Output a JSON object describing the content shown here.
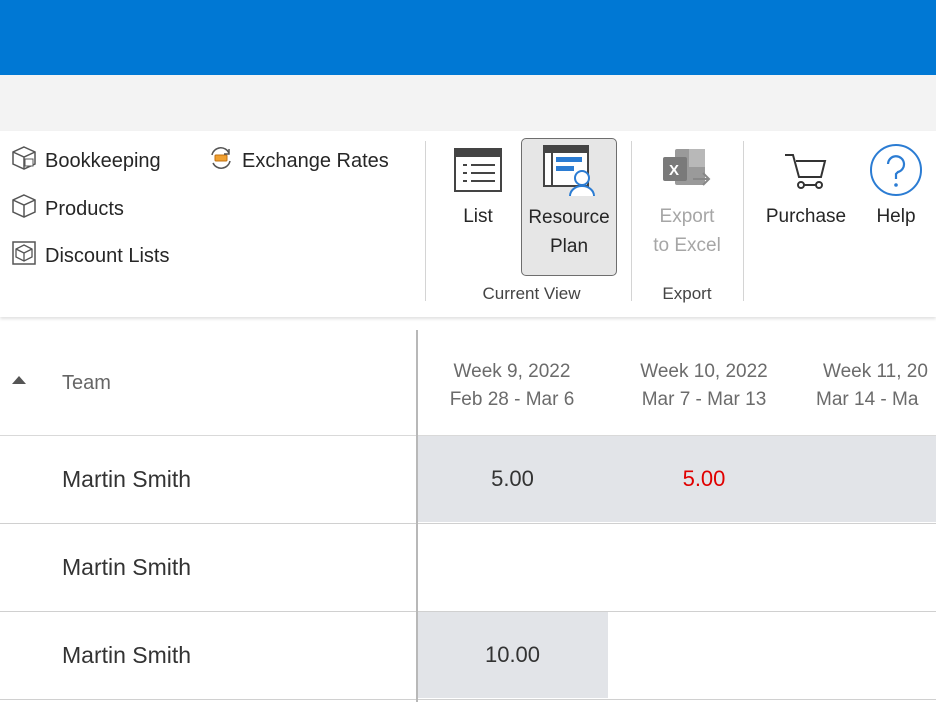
{
  "ribbon": {
    "bookkeeping": "Bookkeeping",
    "exchange_rates": "Exchange Rates",
    "products": "Products",
    "discount_lists": "Discount Lists",
    "list": "List",
    "resource_plan_l1": "Resource",
    "resource_plan_l2": "Plan",
    "export_l1": "Export",
    "export_l2": "to Excel",
    "purchase": "Purchase",
    "help": "Help",
    "group_current_view": "Current View",
    "group_export": "Export"
  },
  "grid": {
    "team_header": "Team",
    "weeks": [
      {
        "title": "Week 9, 2022",
        "range": "Feb 28 - Mar 6"
      },
      {
        "title": "Week 10, 2022",
        "range": "Mar 7 - Mar 13"
      },
      {
        "title": "Week 11, 20",
        "range": "Mar 14 - Ma"
      }
    ],
    "rows": [
      {
        "name": "Martin Smith",
        "w9": "5.00",
        "w10": "5.00"
      },
      {
        "name": "Martin Smith"
      },
      {
        "name": "Martin Smith",
        "w9": "10.00"
      }
    ]
  },
  "colors": {
    "titlebar": "#0078d4",
    "overallocated": "#e00000",
    "shaded_cell": "#e2e4e8"
  }
}
